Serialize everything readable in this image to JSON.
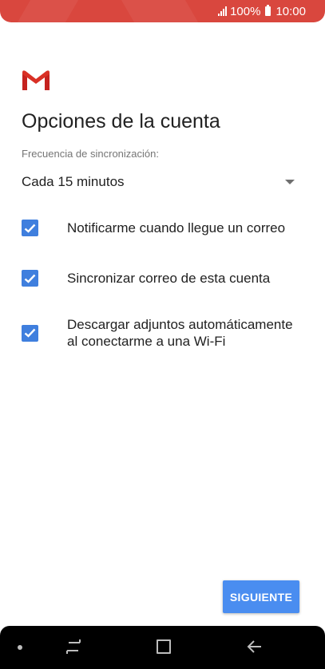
{
  "status_bar": {
    "battery": "100%",
    "time": "10:00"
  },
  "logo": {
    "icon": "gmail-icon"
  },
  "page": {
    "title": "Opciones de la cuenta"
  },
  "sync": {
    "label": "Frecuencia de sincronización:",
    "value": "Cada 15 minutos"
  },
  "options": [
    {
      "label": "Notificarme cuando llegue un correo",
      "checked": true
    },
    {
      "label": "Sincronizar correo de esta cuenta",
      "checked": true
    },
    {
      "label": "Descargar adjuntos automáticamente al conectarme a una Wi-Fi",
      "checked": true
    }
  ],
  "actions": {
    "next_label": "SIGUIENTE"
  },
  "nav": {
    "recents_icon": "recents-icon",
    "home_icon": "home-icon",
    "back_icon": "back-icon"
  },
  "colors": {
    "status_bar": "#d9473e",
    "accent": "#4a8df0",
    "checkbox": "#3f7fde"
  }
}
